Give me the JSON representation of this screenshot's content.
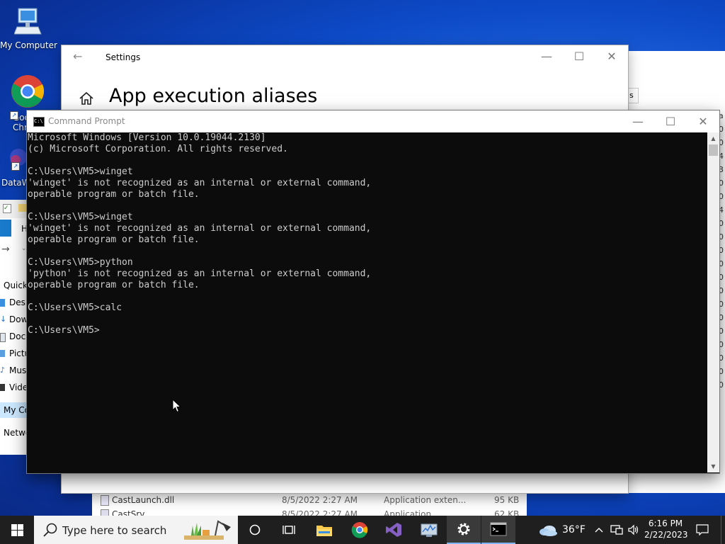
{
  "desktop": {
    "icons": [
      {
        "label": "My Computer"
      },
      {
        "label": "Goo Chr"
      },
      {
        "label": "DataW"
      }
    ]
  },
  "explorer": {
    "nav_items": [
      "H",
      "Quick",
      "Desk",
      "Dow",
      "Docu",
      "Pictu",
      "Musi",
      "Vide",
      "My Co",
      "Netwo"
    ],
    "right_tab_fragment": "s",
    "right_column_chars": [
      "a",
      "0",
      "0",
      "4",
      "3",
      "0",
      "0",
      "4",
      "0",
      "0",
      "0",
      "0",
      "0",
      "0",
      "0",
      "0",
      "0",
      "0",
      "0",
      "0",
      "0"
    ],
    "files": [
      {
        "name": "CastLaunch.dll",
        "date": "8/5/2022 2:27 AM",
        "type": "Application exten...",
        "size": "95 KB"
      },
      {
        "name": "CastSrv",
        "date": "8/5/2022 2:27 AM",
        "type": "Application",
        "size": "62 KB"
      }
    ]
  },
  "settings": {
    "window_title": "Settings",
    "page_heading": "App execution aliases"
  },
  "cmd": {
    "window_title": "Command Prompt",
    "console_lines": [
      "Microsoft Windows [Version 10.0.19044.2130]",
      "(c) Microsoft Corporation. All rights reserved.",
      "",
      "C:\\Users\\VM5>winget",
      "'winget' is not recognized as an internal or external command,",
      "operable program or batch file.",
      "",
      "C:\\Users\\VM5>winget",
      "'winget' is not recognized as an internal or external command,",
      "operable program or batch file.",
      "",
      "C:\\Users\\VM5>python",
      "'python' is not recognized as an internal or external command,",
      "operable program or batch file.",
      "",
      "C:\\Users\\VM5>calc",
      "",
      "C:\\Users\\VM5>"
    ]
  },
  "taskbar": {
    "search_placeholder": "Type here to search",
    "weather_temp": "36°F",
    "time": "6:16 PM",
    "date": "2/22/2023"
  },
  "colors": {
    "console_bg": "#0c0c0c",
    "console_text": "#cccccc",
    "taskbar_bg": "#1f1f1f",
    "accent": "#0078d7"
  }
}
